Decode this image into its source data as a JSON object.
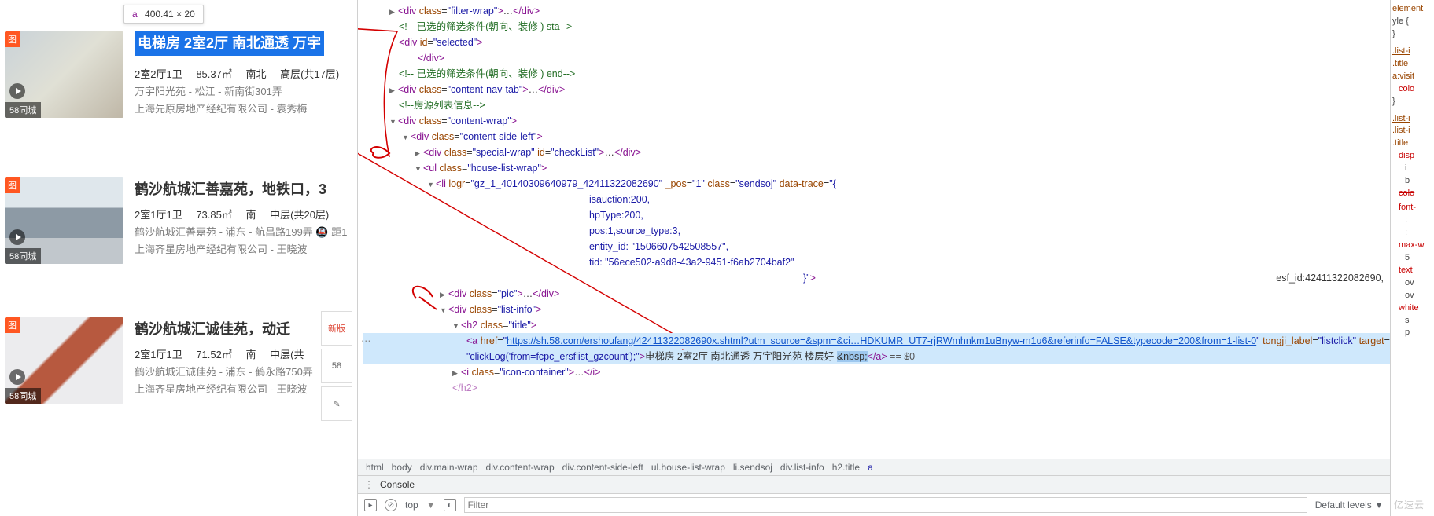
{
  "tooltip": {
    "tag": "a",
    "dims": "400.41 × 20"
  },
  "listings": [
    {
      "tag_tl": "图",
      "tag_bl": "58同城",
      "title": "电梯房 2室2厅 南北通透 万宇",
      "spec_rooms": "2室2厅1卫",
      "spec_area": "85.37㎡",
      "spec_face": "南北",
      "spec_floor": "高层(共17层)",
      "addr": "万宇阳光苑 - 松江  - 新南街301弄",
      "agency": "上海先原房地产经纪有限公司 - 袁秀梅"
    },
    {
      "tag_tl": "图",
      "tag_bl": "58同城",
      "title": "鹤沙航城汇善嘉苑，地铁口，3",
      "spec_rooms": "2室1厅1卫",
      "spec_area": "73.85㎡",
      "spec_face": "南",
      "spec_floor": "中层(共20层)",
      "addr": "鹤沙航城汇善嘉苑 - 浦东 - 航昌路199弄   🚇 距1",
      "agency": "上海齐星房地产经纪有限公司 - 王晓波"
    },
    {
      "tag_tl": "图",
      "tag_bl": "58同城",
      "title": "鹤沙航城汇诚佳苑，动迁",
      "spec_rooms": "2室1厅1卫",
      "spec_area": "71.52㎡",
      "spec_face": "南",
      "spec_floor": "中层(共",
      "addr": "鹤沙航城汇诚佳苑 - 浦东 - 鹤永路750弄",
      "agency": "上海齐星房地产经纪有限公司 - 王晓波"
    }
  ],
  "float": {
    "a": "新版",
    "b": "58",
    "c": "✎"
  },
  "dom": {
    "l1": "<div class=\"filter-wrap\">…</div>",
    "l2": "<!-- 已选的筛选条件(朝向、装修 ) sta-->",
    "l3": "<div id=\"selected\">",
    "l4": "</div>",
    "l5": "<!-- 已选的筛选条件(朝向、装修 ) end-->",
    "l6": "<div class=\"content-nav-tab\">…</div>",
    "l7": "<!--房源列表信息-->",
    "l8": "<div class=\"content-wrap\">",
    "l9": "<div class=\"content-side-left\">",
    "l10": "<div class=\"special-wrap\" id=\"checkList\">…</div>",
    "l11": "<ul class=\"house-list-wrap\">",
    "l12": "<li logr=\"gz_1_40140309640979_42411322082690\" _pos=\"1\" class=\"sendsoj\" data-trace=\"{",
    "l13": "isauction:200,",
    "l14": "hpType:200,",
    "l15": "pos:1,source_type:3,",
    "l16": "entity_id: \"1506607542508557\",",
    "l17": "tid: \"56ece502-a9d8-43a2-9451-f6ab2704baf2\"",
    "l18": "}\">",
    "l19": "<div class=\"pic\">…</div>",
    "l20": "<div class=\"list-info\">",
    "l21": "<h2 class=\"title\">",
    "l22a": "<a href=\"",
    "l22_href": "https://sh.58.com/ershoufang/42411322082690x.shtml?utm_source=&spm=&ci…HDKUMR_UT7-rjRWmhnkm1uBnyw-m1u6&referinfo=FALSE&typecode=200&from=1-list-0",
    "l22b": "\" tongji_label=\"listclick\" target=\"_blank\" onclick=",
    "l23a": "\"clickLog('from=fcpc_ersflist_gzcount');\">",
    "l23_txt": "电梯房 2室2厅 南北通透 万宇阳光苑 楼层好 ",
    "l23_nbsp": "&nbsp;",
    "l23_c": "</a>",
    "l23_eq": " == $0",
    "l24": "<i class=\"icon-container\">…</i>",
    "l25": "</h2>",
    "esf": "esf_id:42411322082690,"
  },
  "crumbs": [
    "html",
    "body",
    "div.main-wrap",
    "div.content-wrap",
    "div.content-side-left",
    "ul.house-list-wrap",
    "li.sendsoj",
    "div.list-info",
    "h2.title",
    "a"
  ],
  "console": {
    "label": "Console",
    "ctx": "top",
    "filter_ph": "Filter",
    "levels": "Default levels ▼",
    "eye": "◐"
  },
  "styles": {
    "r1": "element",
    "r2": "yle {",
    "r3": "}",
    "r4": ".list-i",
    "r5": ".title",
    "r6": "a:visit",
    "r7": "colo",
    "r8": "}",
    "r9": ".list-i",
    "r10": ".list-i",
    "r11": ".title",
    "r12": "disp",
    "r13": "i",
    "r14": "b",
    "r15": "colo",
    "r16": "font-",
    "r17": ":",
    "r18": ":",
    "r19": "max-w",
    "r20": "5",
    "r21": "text",
    "r22": "ov",
    "r23": "ov",
    "r24": "white",
    "r25": "s",
    "r26": "p"
  },
  "watermark": "亿速云"
}
